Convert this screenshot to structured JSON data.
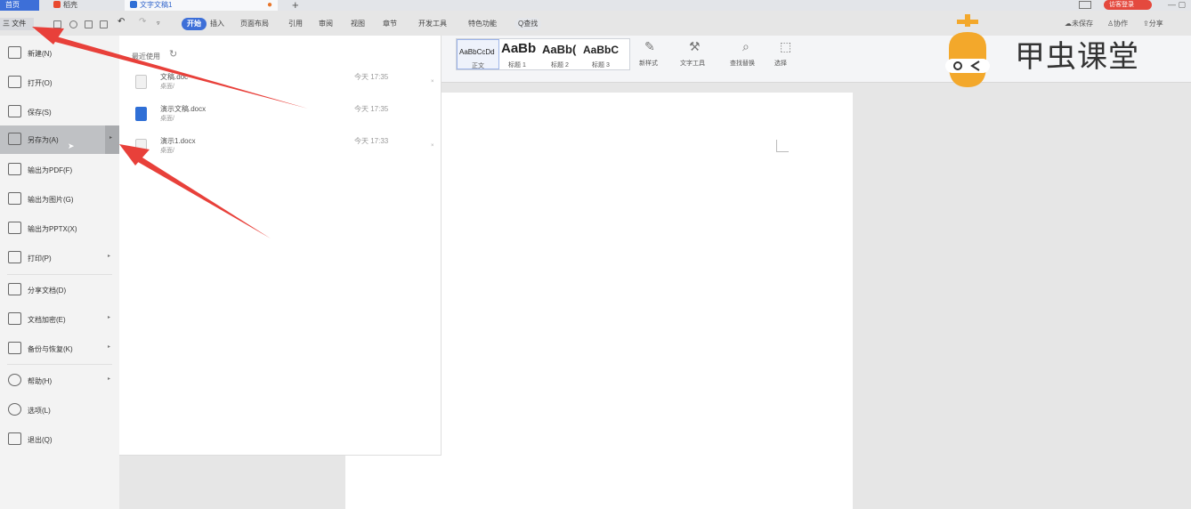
{
  "tabbar": {
    "home": "首页",
    "daoke": "稻壳",
    "doc": "文字文稿1",
    "login": "访客登录"
  },
  "toolbar": {
    "file": "三 文件",
    "tabs": [
      "开始",
      "插入",
      "页面布局",
      "引用",
      "审阅",
      "视图",
      "章节",
      "开发工具",
      "特色功能",
      "Q查找"
    ],
    "right": [
      "未保存",
      "协作",
      "分享"
    ]
  },
  "ribbon": {
    "styles": [
      {
        "sample": "AaBbCcDd",
        "label": "正文"
      },
      {
        "sample": "AaBb",
        "label": "标题 1"
      },
      {
        "sample": "AaBb(",
        "label": "标题 2"
      },
      {
        "sample": "AaBbC",
        "label": "标题 3"
      }
    ],
    "tools": [
      "新样式",
      "文字工具",
      "查找替换",
      "选择"
    ]
  },
  "file_menu": {
    "items": [
      {
        "label": "新建(N)",
        "icon": "new-doc-icon"
      },
      {
        "label": "打开(O)",
        "icon": "folder-open-icon"
      },
      {
        "label": "保存(S)",
        "icon": "save-icon"
      },
      {
        "label": "另存为(A)",
        "icon": "save-as-icon"
      },
      {
        "label": "输出为PDF(F)",
        "icon": "pdf-export-icon"
      },
      {
        "label": "输出为图片(G)",
        "icon": "image-export-icon"
      },
      {
        "label": "输出为PPTX(X)",
        "icon": "pptx-export-icon"
      },
      {
        "label": "打印(P)",
        "icon": "print-icon"
      },
      {
        "label": "分享文档(D)",
        "icon": "share-icon"
      },
      {
        "label": "文档加密(E)",
        "icon": "encrypt-icon"
      },
      {
        "label": "备份与恢复(K)",
        "icon": "backup-icon"
      },
      {
        "label": "帮助(H)",
        "icon": "help-icon"
      },
      {
        "label": "选项(L)",
        "icon": "options-icon"
      },
      {
        "label": "退出(Q)",
        "icon": "exit-icon"
      }
    ]
  },
  "recent": {
    "title": "最近使用",
    "files": [
      {
        "name": "文稿.doc",
        "path": "桌面/",
        "time": "今天 17:35"
      },
      {
        "name": "演示文稿.docx",
        "path": "桌面/",
        "time": "今天 17:35"
      },
      {
        "name": "演示1.docx",
        "path": "桌面/",
        "time": "今天 17:33"
      }
    ]
  },
  "logo": {
    "text": "甲虫课堂"
  }
}
